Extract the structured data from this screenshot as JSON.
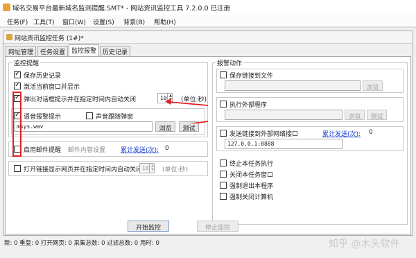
{
  "window": {
    "title": "域名交易平台最新域名监测提醒.SMT* - 网站资讯监控工具 7.2.0.0 已注册"
  },
  "menu": [
    "任务(F)",
    "工具(T)",
    "窗口(W)",
    "设置(S)",
    "背景(B)",
    "帮助(H)"
  ],
  "child_window": {
    "title": "网站资讯监控任务 (1#)*"
  },
  "tabs": [
    "网址管理",
    "任务设置",
    "监控报警",
    "历史记录"
  ],
  "alert_group": {
    "title": "监控提醒",
    "save_history": {
      "label": "保存历史记录",
      "checked": true
    },
    "activate_window": {
      "label": "激活当前窗口并显示",
      "checked": true
    },
    "popup": {
      "label": "弹出对话框提示并在指定时间内自动关闭",
      "checked": true,
      "value": "10",
      "unit": "(单位:秒)"
    },
    "sound": {
      "label": "语音报警提示",
      "checked": true,
      "follow_label": "声音跟随弹窗",
      "follow_checked": false,
      "file": "msys.wav",
      "browse": "浏览",
      "test": "测试"
    },
    "email": {
      "label": "启用邮件提醒",
      "checked": false,
      "content_label": "邮件内容设置",
      "sent_label": "累计发送(次):",
      "sent_count": "0"
    },
    "open_link": {
      "label": "打开链接显示网页并在指定时间内自动关闭",
      "checked": false,
      "value": "10",
      "unit": "(单位:秒)"
    }
  },
  "action_group": {
    "title": "报警动作",
    "save_link": {
      "label": "保存链接到文件",
      "checked": false,
      "browse": "浏览"
    },
    "run_program": {
      "label": "执行外部程序",
      "checked": false,
      "browse": "浏览",
      "test": "测试"
    },
    "send_link": {
      "label": "发送链接到外部网络接口",
      "checked": false,
      "sent_label": "累计发送(次):",
      "sent_count": "0",
      "address": "127.0.0.1:8888"
    },
    "stop_task": {
      "label": "终止本任务执行",
      "checked": false
    },
    "close_window": {
      "label": "关闭本任务窗口",
      "checked": false
    },
    "exit_app": {
      "label": "强制退出本程序",
      "checked": false
    },
    "shutdown": {
      "label": "强制关闭计算机",
      "checked": false
    }
  },
  "buttons": {
    "start": "开始监控",
    "stop": "停止监控"
  },
  "status_bar": "新: 0 重复: 0 打开网页: 0 采集总数: 0 过滤总数: 0 用时: 0",
  "watermark": "知乎 @木头软件",
  "colors": {
    "highlight": "#e02020",
    "link": "#1a3fd0"
  }
}
